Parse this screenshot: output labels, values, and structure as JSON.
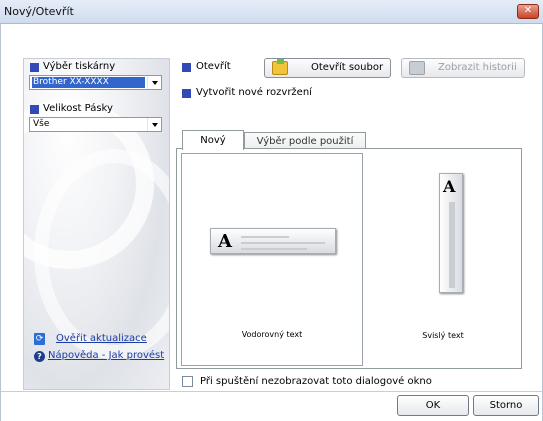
{
  "window": {
    "title": "Nový/Otevřít",
    "close_glyph": "✕"
  },
  "left": {
    "printer_label": "Výběr tiskárny",
    "printer_value": "Brother XX-XXXX",
    "tape_label": "Velikost Pásky",
    "tape_value": "Vše",
    "update_link": "Ověřit aktualizace",
    "help_link": "Nápověda - Jak provést"
  },
  "open": {
    "label": "Otevřít",
    "open_file_button": "Otevřít soubor",
    "history_button": "Zobrazit historii"
  },
  "new_layout": {
    "label": "Vytvořit nové rozvržení",
    "tabs": [
      {
        "label": "Nový"
      },
      {
        "label": "Výběr podle použití"
      }
    ],
    "cards": [
      {
        "caption": "Vodorovný text",
        "glyph": "A"
      },
      {
        "caption": "Svislý text",
        "glyph": "A"
      }
    ]
  },
  "footer": {
    "checkbox_label": "Při spuštění nezobrazovat toto dialogové okno",
    "ok_button": "OK",
    "cancel_button": "Storno"
  },
  "colors": {
    "accent": "#3449b8",
    "link": "#1a3aa8",
    "selection": "#3366cc"
  }
}
